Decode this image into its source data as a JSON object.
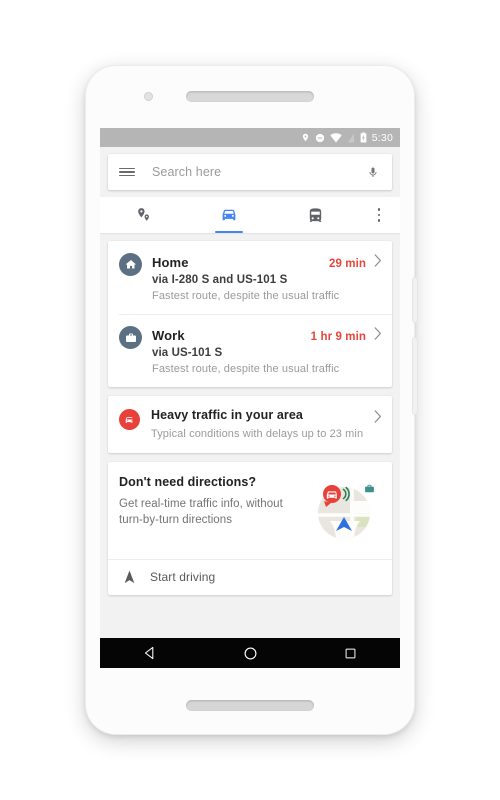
{
  "device": {
    "camera": "front-camera",
    "speaker_top": "earpiece-grille",
    "speaker_bottom": "speaker-grille"
  },
  "statusbar": {
    "time": "5:30",
    "icons": [
      "location-icon",
      "do-not-disturb-icon",
      "wifi-icon",
      "signal-icon",
      "battery-icon"
    ]
  },
  "search": {
    "placeholder": "Search here",
    "menu_icon": "hamburger-menu-icon",
    "voice_icon": "microphone-icon"
  },
  "tabs": [
    {
      "name": "explore",
      "icon": "explore-pins-icon",
      "active": false
    },
    {
      "name": "driving",
      "icon": "car-icon",
      "active": true
    },
    {
      "name": "transit",
      "icon": "transit-bus-icon",
      "active": false
    },
    {
      "name": "overflow",
      "icon": "kebab-menu-icon",
      "active": false
    }
  ],
  "destinations": [
    {
      "icon": "home-icon",
      "name": "Home",
      "eta": "29 min",
      "via": "via I-280 S and US-101 S",
      "note": "Fastest route, despite the usual traffic"
    },
    {
      "icon": "work-briefcase-icon",
      "name": "Work",
      "eta": "1 hr 9 min",
      "via": "via US-101 S",
      "note": "Fastest route, despite the usual traffic"
    }
  ],
  "traffic": {
    "icon": "traffic-alert-icon",
    "title": "Heavy traffic in your area",
    "subtitle": "Typical conditions with delays up to 23 min"
  },
  "promo": {
    "title": "Don't need directions?",
    "subtitle": "Get real-time traffic info, without turn-by-turn directions",
    "illustration": "map-with-navigation-arrow-illustration",
    "action_icon": "navigation-arrow-icon",
    "action_label": "Start driving"
  },
  "navbar": {
    "back": "back-triangle-icon",
    "home": "home-circle-icon",
    "recents": "recents-square-icon"
  },
  "colors": {
    "accent_blue": "#4285f4",
    "eta_red": "#e8453c",
    "traffic_red": "#e8413a",
    "dest_icon_slate": "#5b7083",
    "page_bg": "#f2f2f2",
    "statusbar_gray": "#b5b5b5"
  }
}
